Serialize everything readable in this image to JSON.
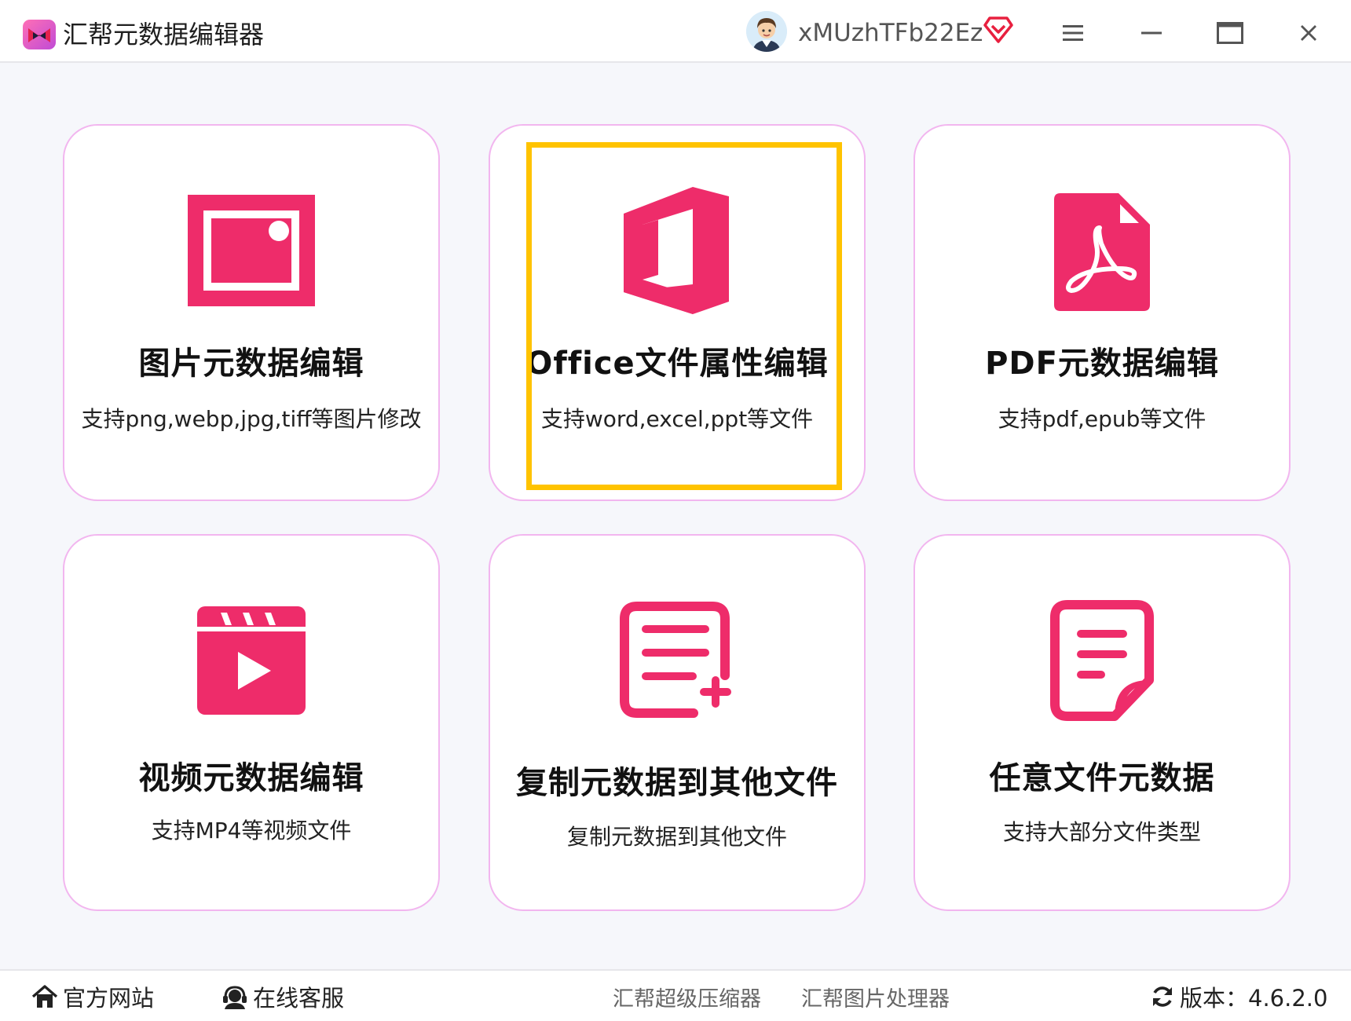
{
  "window": {
    "title": "汇帮元数据编辑器",
    "username": "xMUzhTFb22Ez",
    "brand_color": "#ee2c6a",
    "icons": [
      "app-logo-icon",
      "user-avatar",
      "vip-diamond-icon",
      "menu-icon",
      "minimize-icon",
      "maximize-icon",
      "close-icon"
    ]
  },
  "cards": [
    {
      "title": "图片元数据编辑",
      "desc": "支持png,webp,jpg,tiff等图片修改",
      "icon": "image-icon"
    },
    {
      "title": "Office文件属性编辑",
      "desc": "支持word,excel,ppt等文件",
      "icon": "office-icon",
      "highlighted": true
    },
    {
      "title": "PDF元数据编辑",
      "desc": "支持pdf,epub等文件",
      "icon": "pdf-icon"
    },
    {
      "title": "视频元数据编辑",
      "desc": "支持MP4等视频文件",
      "icon": "video-icon"
    },
    {
      "title": "复制元数据到其他文件",
      "desc": "复制元数据到其他文件",
      "icon": "copy-document-icon"
    },
    {
      "title": "任意文件元数据",
      "desc": "支持大部分文件类型",
      "icon": "document-icon"
    }
  ],
  "footer": {
    "website": "官方网站",
    "support": "在线客服",
    "compressor": "汇帮超级压缩器",
    "image_processor": "汇帮图片处理器",
    "version": "版本：4.6.2.0"
  }
}
